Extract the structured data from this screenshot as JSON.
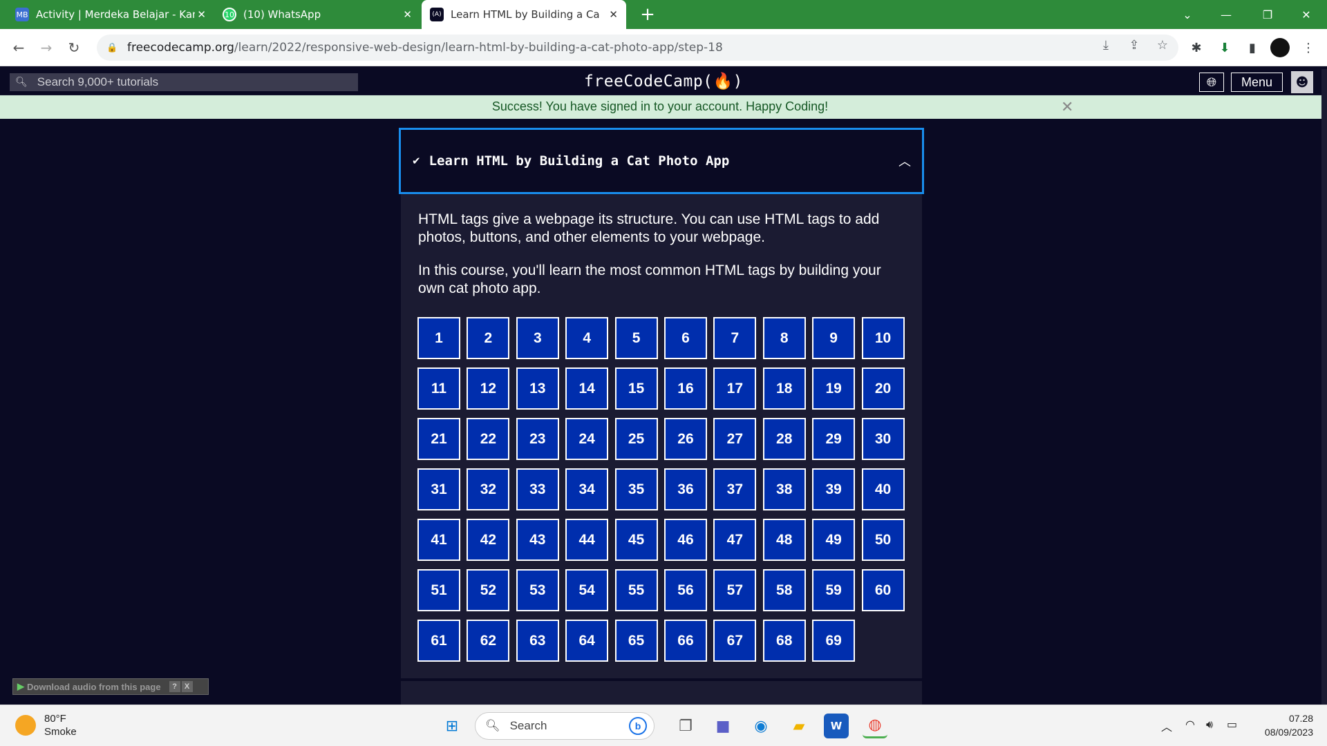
{
  "browser": {
    "tabs": [
      {
        "title": "Activity | Merdeka Belajar - Kamp",
        "favicon": "MB"
      },
      {
        "title": "(10) WhatsApp",
        "favicon": "10"
      },
      {
        "title": "Learn HTML by Building a Cat Ph",
        "favicon": "(A)"
      }
    ],
    "url_host": "freecodecamp.org",
    "url_path": "/learn/2022/responsive-web-design/learn-html-by-building-a-cat-photo-app/step-18"
  },
  "fcc_nav": {
    "search_placeholder": "Search 9,000+ tutorials",
    "logo": "freeCodeCamp(🔥)",
    "menu_label": "Menu"
  },
  "flash": {
    "message": "Success! You have signed in to your account. Happy Coding!"
  },
  "block": {
    "title": "Learn HTML by Building a Cat Photo App",
    "paragraphs": [
      "HTML tags give a webpage its structure. You can use HTML tags to add photos, buttons, and other elements to your webpage.",
      "In this course, you'll learn the most common HTML tags by building your own cat photo app."
    ],
    "steps": [
      "1",
      "2",
      "3",
      "4",
      "5",
      "6",
      "7",
      "8",
      "9",
      "10",
      "11",
      "12",
      "13",
      "14",
      "15",
      "16",
      "17",
      "18",
      "19",
      "20",
      "21",
      "22",
      "23",
      "24",
      "25",
      "26",
      "27",
      "28",
      "29",
      "30",
      "31",
      "32",
      "33",
      "34",
      "35",
      "36",
      "37",
      "38",
      "39",
      "40",
      "41",
      "42",
      "43",
      "44",
      "45",
      "46",
      "47",
      "48",
      "49",
      "50",
      "51",
      "52",
      "53",
      "54",
      "55",
      "56",
      "57",
      "58",
      "59",
      "60",
      "61",
      "62",
      "63",
      "64",
      "65",
      "66",
      "67",
      "68",
      "69"
    ]
  },
  "audio_widget": {
    "label": "Download audio from this page",
    "help": "?",
    "close": "X"
  },
  "taskbar": {
    "weather_temp": "80°F",
    "weather_cond": "Smoke",
    "search_label": "Search",
    "time": "07.28",
    "date": "08/09/2023"
  },
  "colors": {
    "fcc_bg": "#0a0a23",
    "fcc_panel": "#1b1b32",
    "step_blue": "#002ead",
    "header_border": "#198eee",
    "flash_bg": "#d4edda",
    "chrome_green": "#2e8b3a"
  }
}
